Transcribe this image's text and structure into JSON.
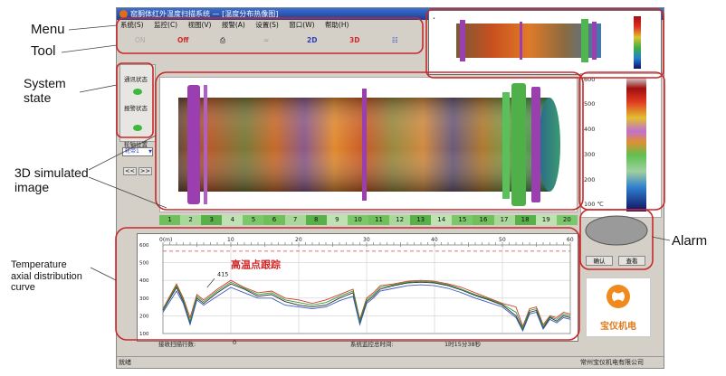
{
  "annotations": {
    "menu": "Menu",
    "tool": "Tool",
    "system_state": "System\nstate",
    "sim_3d": "3D simulated\nimage",
    "temp_curve": "Temperature\naxial distribution\ncurve",
    "alarm": "Alarm"
  },
  "window": {
    "title": "窑胴体红外温度扫描系统 — [温度分布热像图]"
  },
  "menu": {
    "items": [
      "系统(S)",
      "监控(C)",
      "视图(V)",
      "报警(A)",
      "设置(S)",
      "窗口(W)",
      "帮助(H)"
    ]
  },
  "toolbar": {
    "on": "ON",
    "off": "Off",
    "print_icon": "printer-icon",
    "wifi_icon": "signal-icon",
    "btn_2d": "2D",
    "btn_3d": "3D",
    "ruler_icon": "ruler-icon"
  },
  "state_panel": {
    "comm_label": "通讯状态",
    "alarm_label": "报警状态"
  },
  "wheel": {
    "label": "轮轴位置",
    "select_value": "轮带1",
    "prev": "<<",
    "next": ">>"
  },
  "colorbar": {
    "ticks": [
      "600",
      "500",
      "400",
      "300",
      "200",
      "100 ℃"
    ]
  },
  "segments": [
    "1",
    "2",
    "3",
    "4",
    "5",
    "6",
    "7",
    "8",
    "9",
    "10",
    "11",
    "12",
    "13",
    "14",
    "15",
    "16",
    "17",
    "18",
    "19",
    "20"
  ],
  "chart_data": {
    "type": "line",
    "title": "高温点跟踪",
    "annotation": "415",
    "x_ticks": [
      "0(m)",
      "10",
      "20",
      "30",
      "40",
      "50",
      "60"
    ],
    "xlim": [
      0,
      60
    ],
    "y_ticks": [
      "600",
      "500",
      "400",
      "300",
      "200",
      "100"
    ],
    "ylim": [
      100,
      600
    ],
    "grid": true,
    "x": [
      0,
      2,
      3,
      4,
      5,
      6,
      8,
      10,
      12,
      14,
      16,
      18,
      20,
      22,
      24,
      26,
      28,
      29,
      30,
      31,
      32,
      34,
      36,
      38,
      40,
      42,
      44,
      46,
      48,
      50,
      52,
      53,
      54,
      55,
      56,
      57,
      58,
      59,
      60
    ],
    "series": [
      {
        "color": "#d23a2a",
        "values": [
          240,
          380,
          300,
          190,
          320,
          290,
          350,
          400,
          360,
          330,
          340,
          300,
          290,
          270,
          290,
          320,
          350,
          180,
          300,
          330,
          370,
          380,
          395,
          400,
          395,
          380,
          360,
          330,
          300,
          270,
          250,
          140,
          240,
          250,
          150,
          200,
          190,
          220,
          210
        ]
      },
      {
        "color": "#2a2a2a",
        "values": [
          230,
          360,
          280,
          160,
          300,
          270,
          330,
          380,
          350,
          310,
          320,
          280,
          260,
          250,
          260,
          300,
          330,
          160,
          280,
          310,
          350,
          370,
          385,
          390,
          385,
          370,
          345,
          315,
          290,
          260,
          200,
          120,
          220,
          230,
          130,
          190,
          170,
          200,
          190
        ]
      },
      {
        "color": "#3a58c0",
        "values": [
          220,
          340,
          270,
          150,
          290,
          260,
          310,
          360,
          330,
          300,
          300,
          260,
          250,
          240,
          250,
          285,
          310,
          150,
          270,
          300,
          340,
          355,
          370,
          375,
          370,
          355,
          330,
          300,
          275,
          250,
          190,
          115,
          210,
          220,
          125,
          180,
          160,
          190,
          180
        ]
      },
      {
        "color": "#2a9a3a",
        "values": [
          235,
          370,
          290,
          170,
          310,
          280,
          340,
          390,
          355,
          320,
          330,
          290,
          275,
          260,
          275,
          310,
          340,
          170,
          290,
          320,
          360,
          375,
          390,
          395,
          390,
          375,
          350,
          320,
          295,
          265,
          220,
          130,
          230,
          240,
          140,
          195,
          180,
          210,
          200
        ]
      }
    ]
  },
  "alarm_buttons": {
    "confirm": "确认",
    "view": "查看"
  },
  "logo": {
    "text": "宝仪机电"
  },
  "status": {
    "left": "就绪",
    "scan_count_label": "接收扫描行数:",
    "scan_count_value": "0",
    "runtime_label": "系统监控总时间:",
    "runtime_value": "1时15分38秒",
    "company": "常州宝仪机电有限公司"
  },
  "colors": {
    "accent_purple": "#9b3fb0",
    "annotation_red": "#d0282a"
  }
}
